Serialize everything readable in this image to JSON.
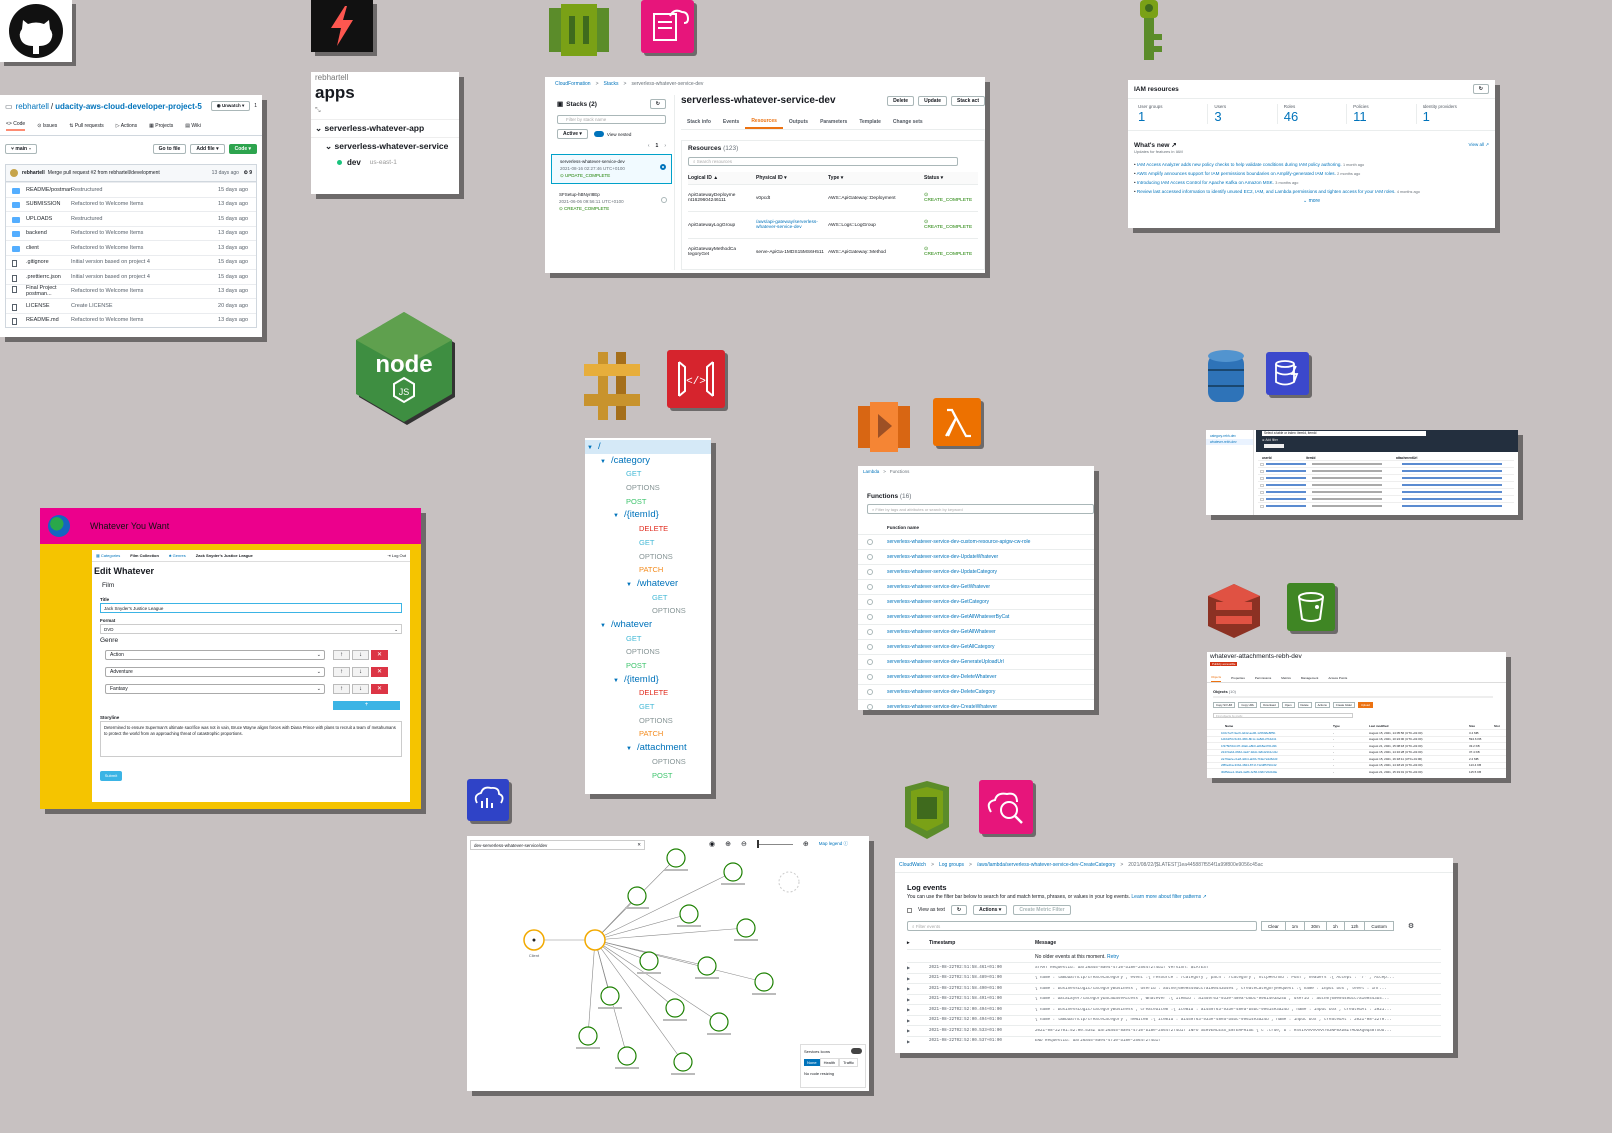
{
  "github": {
    "owner": "rebhartell",
    "sep": "/",
    "repo": "udacity-aws-cloud-developer-project-5",
    "unwatch": "Unwatch",
    "unwatch_count": "1",
    "tabs": [
      "Code",
      "Issues",
      "Pull requests",
      "Actions",
      "Projects",
      "Wiki"
    ],
    "branch": "main",
    "goto": "Go to file",
    "addfile": "Add file",
    "code": "Code",
    "commit_user": "rebhartell",
    "commit_msg": "Merge pull request #2 from rebhartell/development",
    "commit_time": "13 days ago",
    "commit_count": "9",
    "files": [
      {
        "name": "README/postman",
        "msg": "Restructured",
        "date": "15 days ago",
        "dir": true
      },
      {
        "name": "SUBMISSION",
        "msg": "Refactored to Welcome Items",
        "date": "13 days ago",
        "dir": true
      },
      {
        "name": "UPLOADS",
        "msg": "Restructured",
        "date": "15 days ago",
        "dir": true
      },
      {
        "name": "backend",
        "msg": "Refactored to Welcome Items",
        "date": "13 days ago",
        "dir": true
      },
      {
        "name": "client",
        "msg": "Refactored to Welcome Items",
        "date": "13 days ago",
        "dir": true
      },
      {
        "name": ".gitignore",
        "msg": "Initial version based on project 4",
        "date": "15 days ago",
        "dir": false
      },
      {
        "name": ".prettierrc.json",
        "msg": "Initial version based on project 4",
        "date": "15 days ago",
        "dir": false
      },
      {
        "name": "Final Project postman...",
        "msg": "Refactored to Welcome Items",
        "date": "13 days ago",
        "dir": false
      },
      {
        "name": "LICENSE",
        "msg": "Create LICENSE",
        "date": "20 days ago",
        "dir": false
      },
      {
        "name": "README.md",
        "msg": "Refactored to Welcome Items",
        "date": "13 days ago",
        "dir": false
      }
    ]
  },
  "apps": {
    "owner": "rebhartell",
    "title": "apps",
    "app": "serverless-whatever-app",
    "service": "serverless-whatever-service",
    "stage": "dev",
    "region": "us-east-1"
  },
  "cloudformation": {
    "crumbs": [
      "CloudFormation",
      "Stacks",
      "serverless-whatever-service-dev"
    ],
    "stacks_title": "Stacks (2)",
    "filter_placeholder": "Filter by stack name",
    "active": "Active",
    "view_nested": "View nested",
    "page": "1",
    "stacks": [
      {
        "name": "serverless-whatever-service-dev",
        "date": "2021-08-16 02:27:46 UTC+0100",
        "status": "UPDATE_COMPLETE"
      },
      {
        "name": "SFSetup-hBNyrI8Ep",
        "date": "2021-06-06 09:56:11 UTC+0100",
        "status": "CREATE_COMPLETE"
      }
    ],
    "stack_title": "serverless-whatever-service-dev",
    "buttons": [
      "Delete",
      "Update",
      "Stack act"
    ],
    "tabs": [
      "Stack info",
      "Events",
      "Resources",
      "Outputs",
      "Parameters",
      "Template",
      "Change sets"
    ],
    "resources_title": "Resources",
    "resources_count": "(123)",
    "search_placeholder": "Search resources",
    "columns": [
      "Logical ID",
      "Physical ID",
      "Type",
      "Status"
    ],
    "rows": [
      {
        "id": "ApiGatewayDeployme nt1629604246111",
        "phys": "v0pcdt",
        "type": "AWS::ApiGateway::Deployment",
        "status": "CREATE_COMPLETE"
      },
      {
        "id": "ApiGatewayLogGroup",
        "phys": "/aws/api-gateway/serverless-whatever-service-dev",
        "type": "AWS::Logs::LogGroup",
        "status": "CREATE_COMPLETE"
      },
      {
        "id": "ApiGatewayMethodCa tegoryGet",
        "phys": "serve-ApiGa-1MDS15MS6H511",
        "type": "AWS::ApiGateway::Method",
        "status": "CREATE_COMPLETE"
      }
    ]
  },
  "iam": {
    "title": "IAM resources",
    "stats": [
      {
        "label": "User groups",
        "value": "1"
      },
      {
        "label": "Users",
        "value": "3"
      },
      {
        "label": "Roles",
        "value": "46"
      },
      {
        "label": "Policies",
        "value": "11"
      },
      {
        "label": "Identity providers",
        "value": "1"
      }
    ],
    "whats_new": "What's new",
    "subtitle": "Updates for features in IAM",
    "view_all": "View all",
    "news": [
      {
        "text": "IAM Access Analyzer adds new policy checks to help validate conditions during IAM policy authoring.",
        "when": "1 month ago"
      },
      {
        "text": "AWS Amplify announces support for IAM permissions boundaries on Amplify-generated IAM roles.",
        "when": "2 months ago"
      },
      {
        "text": "Introducing IAM Access Control for Apache Kafka on Amazon MSK.",
        "when": "3 months ago"
      },
      {
        "text": "Review last accessed information to identify unused EC2, IAM, and Lambda permissions and tighten access for your IAM roles.",
        "when": "4 months ago"
      }
    ],
    "more": "more"
  },
  "whatever": {
    "app_title": "Whatever You Want",
    "nav": [
      "Categories",
      "Film Collection",
      "Genres",
      "Zack Snyder's Justice League"
    ],
    "logout": "Log Out",
    "heading": "Edit Whatever",
    "section": "Film",
    "title_label": "Title",
    "title_value": "Jack Snyder's Justice League",
    "format_label": "Format",
    "format_value": "DVD",
    "genre_label": "Genre",
    "genres": [
      "Action",
      "Adventure",
      "Fantasy"
    ],
    "storyline_label": "Storyline",
    "storyline": "Determined to ensure Superman's ultimate sacrifice was not in vain, Bruce Wayne aligns forces with Diana Prince with plans to recruit a team of metahumans to protect the world from an approaching threat of catastrophic proportions.",
    "submit": "Submit",
    "colors": {
      "header": "#ec008c",
      "frame": "#f5c400",
      "button": "#3bb4e5"
    }
  },
  "api_tree": [
    {
      "t": "/",
      "d": 0,
      "k": "path"
    },
    {
      "t": "/category",
      "d": 1,
      "k": "path"
    },
    {
      "t": "GET",
      "d": 2,
      "k": "get"
    },
    {
      "t": "OPTIONS",
      "d": 2,
      "k": "options"
    },
    {
      "t": "POST",
      "d": 2,
      "k": "post"
    },
    {
      "t": "/{itemId}",
      "d": 2,
      "k": "path"
    },
    {
      "t": "DELETE",
      "d": 3,
      "k": "delete"
    },
    {
      "t": "GET",
      "d": 3,
      "k": "get"
    },
    {
      "t": "OPTIONS",
      "d": 3,
      "k": "options"
    },
    {
      "t": "PATCH",
      "d": 3,
      "k": "patch"
    },
    {
      "t": "/whatever",
      "d": 3,
      "k": "path"
    },
    {
      "t": "GET",
      "d": 4,
      "k": "get"
    },
    {
      "t": "OPTIONS",
      "d": 4,
      "k": "options"
    },
    {
      "t": "/whatever",
      "d": 1,
      "k": "path"
    },
    {
      "t": "GET",
      "d": 2,
      "k": "get"
    },
    {
      "t": "OPTIONS",
      "d": 2,
      "k": "options"
    },
    {
      "t": "POST",
      "d": 2,
      "k": "post"
    },
    {
      "t": "/{itemId}",
      "d": 2,
      "k": "path"
    },
    {
      "t": "DELETE",
      "d": 3,
      "k": "delete"
    },
    {
      "t": "GET",
      "d": 3,
      "k": "get"
    },
    {
      "t": "OPTIONS",
      "d": 3,
      "k": "options"
    },
    {
      "t": "PATCH",
      "d": 3,
      "k": "patch"
    },
    {
      "t": "/attachment",
      "d": 3,
      "k": "path"
    },
    {
      "t": "OPTIONS",
      "d": 4,
      "k": "options"
    },
    {
      "t": "POST",
      "d": 4,
      "k": "post"
    }
  ],
  "lambda": {
    "crumbs": [
      "Lambda",
      "Functions"
    ],
    "title": "Functions",
    "count": "(16)",
    "filter": "Filter by tags and attributes or search by keyword",
    "col": "Function name",
    "functions": [
      "serverless-whatever-service-dev-custom-resource-apigw-cw-role",
      "serverless-whatever-service-dev-UpdateWhatever",
      "serverless-whatever-service-dev-UpdateCategory",
      "serverless-whatever-service-dev-GetWhatever",
      "serverless-whatever-service-dev-GetCategory",
      "serverless-whatever-service-dev-GetAllWhateverByCat",
      "serverless-whatever-service-dev-GetAllWhatever",
      "serverless-whatever-service-dev-GetAllCategory",
      "serverless-whatever-service-dev-GenerateUploadUrl",
      "serverless-whatever-service-dev-DeleteWhatever",
      "serverless-whatever-service-dev-DeleteCategory",
      "serverless-whatever-service-dev-CreateWhatever"
    ]
  },
  "xray": {
    "search": "dev-serverless-whatever-service/dev",
    "map_legend": "Map legend",
    "service_icons": "Services Icons",
    "options": [
      "None",
      "Health",
      "Traffic"
    ],
    "no_resize": "No node resizing",
    "client": "Client"
  },
  "cloudwatch": {
    "crumbs": [
      "CloudWatch",
      "Log groups",
      "/aws/lambda/serverless-whatever-service-dev-CreateCategory",
      "2021/08/22/[$LATEST]1ea445887f554f1a99f800e9056c45ac"
    ],
    "title": "Log events",
    "desc": "You can use the filter bar below to search for and match terms, phrases, or values in your log events.",
    "learn": "Learn more about filter patterns",
    "view_text": "View as text",
    "actions": "Actions",
    "create_metric": "Create Metric Filter",
    "filter": "Filter events",
    "ranges": [
      "Clear",
      "1m",
      "30m",
      "1h",
      "12h",
      "Custom"
    ],
    "col_time": "Timestamp",
    "col_msg": "Message",
    "no_older": "No older events at this moment.",
    "retry": "Retry",
    "events": [
      {
        "t": "2021-08-22T02:51:58.461+01:00",
        "m": "START RequestId: daf26a45-8ae4-4710-b18e-2564f2f4d1f Version: $LATEST"
      },
      {
        "t": "2021-08-22T02:51:58.489+01:00",
        "m": "{\"name\":\"lambda/http/createCategory\",\"event\":{\"resource\":\"/category\",\"path\":\"/category\",\"httpMethod\":\"POST\",\"headers\":{\"Accept\":\"*/*\",\"Accep..."
      },
      {
        "t": "2021-08-22T02:51:58.490+01:00",
        "m": "{\"name\":\"businessLogic/categoryBusiness\",\"userId\":\"auth0|60e0449dcc7a100443b4e4\",\"createCategoryRequest\":{\"name\":\"input box\",\"level\":\"Inf..."
      },
      {
        "t": "2021-08-22T02:51:58.491+01:00",
        "m": "{\"name\":\"dataLayer/categoryDatabaseAccess\",\"whatever\":{\"itemId\":\"a1459f63-933e-48ea-b5bc-99614e3a24b\",\"userId\":\"auth0|60e0449dcc7a100443b4..."
      },
      {
        "t": "2021-08-22T02:52:00.494+01:00",
        "m": "{\"name\":\"businessLogic/categoryBusiness\",\"createdItem\":{\"itemId\":\"a1459f63-933e-48ea-b5bc-99614e3a24b\",\"name\":\"input box\",\"createdAt\":\"2021..."
      },
      {
        "t": "2021-08-22T02:52:00.494+01:00",
        "m": "{\"name\":\"lambda/http/createCategory\",\"newItem\":{\"itemId\":\"a1459f63-933e-48ea-b5bc-99614e3a24b\",\"name\":\"input box\",\"createdAt\":\"2021-08-22T0..."
      },
      {
        "t": "2021-08-22T02:52:00.533+01:00",
        "m": "2021-08-22T01:52:00.534Z daf26a45-8ae4-4710-b18e-2564f2f4d1f INFO SERVERLESS_ENTERPRISE {\"c\":true,\"b\":\"H4sIAAAAAAAA703NP8XD8Z7MDDXQ0qS8TXOU..."
      },
      {
        "t": "2021-08-22T02:52:00.537+01:00",
        "m": "END RequestId: daf26a45-8ae4-4710-b18e-2564f2f4d1f"
      }
    ]
  },
  "dynamo": {
    "sidebar": [
      "category-rebh-dev",
      "whatever-rebh-dev"
    ],
    "query": "Select a table or index: itemId, itemId",
    "filter_btn": "Add filter",
    "cols": [
      "userId",
      "itemId",
      "attachmentUrl"
    ]
  },
  "s3": {
    "title": "whatever-attachments-rebh-dev",
    "badge": "Publicly accessible",
    "tabs": [
      "Objects",
      "Properties",
      "Permissions",
      "Metrics",
      "Management",
      "Access Points"
    ],
    "objects": "Objects",
    "count": "(10)",
    "cols": [
      "Name",
      "Type",
      "Last modified",
      "Size",
      "Stor"
    ],
    "actions": [
      "Copy S3 URI",
      "Copy URL",
      "Download",
      "Open",
      "Delete",
      "Actions",
      "Create folder",
      "Upload"
    ],
    "find": "Find objects by prefix",
    "rows": [
      {
        "n": "1b6c7a7f-9ec6-4d42-ae06-1c56b8e8ff5b",
        "d": "August 15, 2021, 14:05:56 (UTC+01:00)",
        "s": "3.4 MB"
      },
      {
        "n": "1dbb2f54-5c46-4f0b-8b1c-1a8d1d7b4d41",
        "d": "August 16, 2021, 10:24:00 (UTC+01:00)",
        "s": "594.6 KB"
      },
      {
        "n": "1f375b59-b4f7-40ab-a8b0-a0b8a4701d3b",
        "d": "August 21, 2021, 15:08:18 (UTC+01:00)",
        "s": "33.2 KB"
      },
      {
        "n": "2247dab4-0662-4a47-9ddc-32bd21b1cd1c",
        "d": "August 15, 2021, 14:16:28 (UTC+01:00)",
        "s": "37.4 KB"
      },
      {
        "n": "2a7f4a2e-c1a8-4db4-ab9b-7b9e7a3d62d3",
        "d": "August 15, 2021, 16:18:11 (UTC+01:00)",
        "s": "2.2 MB"
      },
      {
        "n": "2f86e2ba-33b2-4824-871f-712d85790c42",
        "d": "August 15, 2021, 14:18:22 (UTC+01:00)",
        "s": "113.4 KB"
      },
      {
        "n": "3b85dee1-3ba9-4e8b-bc56-bf2b7e5c0d0e",
        "d": "August 21, 2021, 15:19:01 (UTC+01:00)",
        "s": "115.5 KB"
      }
    ]
  }
}
